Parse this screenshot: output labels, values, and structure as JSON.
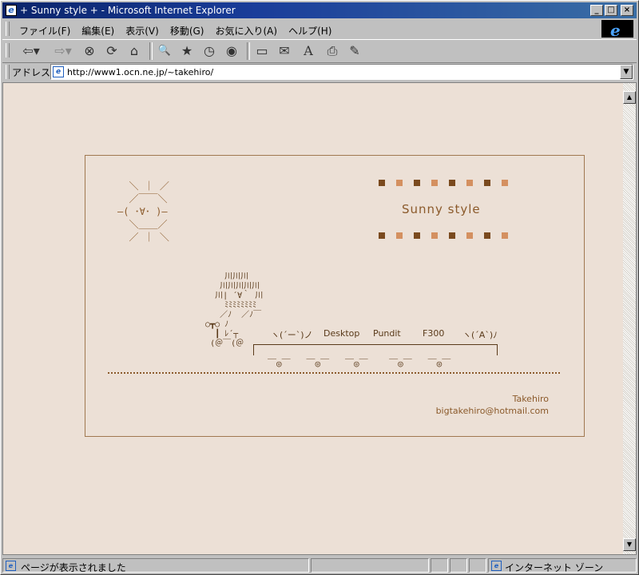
{
  "window": {
    "title": "+ Sunny style + - Microsoft Internet Explorer",
    "buttons": [
      "_",
      "□",
      "×"
    ]
  },
  "menu": [
    "ファイル(F)",
    "編集(E)",
    "表示(V)",
    "移動(G)",
    "お気に入り(A)",
    "ヘルプ(H)"
  ],
  "toolbar": [
    {
      "name": "back-button",
      "glyph": "⇦▾"
    },
    {
      "name": "forward-button",
      "glyph": "⇨▾"
    },
    {
      "name": "stop-button",
      "glyph": "⊗"
    },
    {
      "name": "refresh-button",
      "glyph": "⟳"
    },
    {
      "name": "home-button",
      "glyph": "⌂"
    },
    {
      "name": "search-button",
      "glyph": "🔍"
    },
    {
      "name": "favorites-button",
      "glyph": "★"
    },
    {
      "name": "history-button",
      "glyph": "◷"
    },
    {
      "name": "channels-button",
      "glyph": "◉"
    },
    {
      "name": "fullscreen-button",
      "glyph": "▭"
    },
    {
      "name": "mail-button",
      "glyph": "✉"
    },
    {
      "name": "font-button",
      "glyph": "A"
    },
    {
      "name": "print-button",
      "glyph": "⎙"
    },
    {
      "name": "edit-button",
      "glyph": "✎"
    }
  ],
  "address": {
    "label": "アドレス",
    "url": "http://www1.ocn.ne.jp/~takehiro/"
  },
  "page": {
    "title": "Sunny style",
    "sun_art": "  ＼ ｜ ／\n  ／￣￣＼\n―( ･∀･ )―\n  ＼＿＿／\n  ／ ｜ ＼",
    "train_art": "       川川川\n      川川川川川\n     川| ´∀｀ 川\n       ﾐﾐﾐﾐﾐﾐﾐﾐ\n      ／ﾉ  ／ﾉ￣\n   ○┳○ ﾉ\n     ┃ ﾚ´┬\n    (＠￣(＠",
    "train_cars": [
      "ヽ(´ー`)ノ",
      "Desktop",
      "Pundit",
      "F300",
      "ヽ(´A`)ﾉ"
    ],
    "author": "Takehiro",
    "email": "bigtakehiro@hotmail.com",
    "square_colors": [
      "#7a4a1e",
      "#d49060",
      "#7a4a1e",
      "#d49060",
      "#7a4a1e",
      "#d49060",
      "#7a4a1e",
      "#d49060"
    ]
  },
  "status": {
    "text": "ページが表示されました",
    "zone": "インターネット ゾーン"
  }
}
